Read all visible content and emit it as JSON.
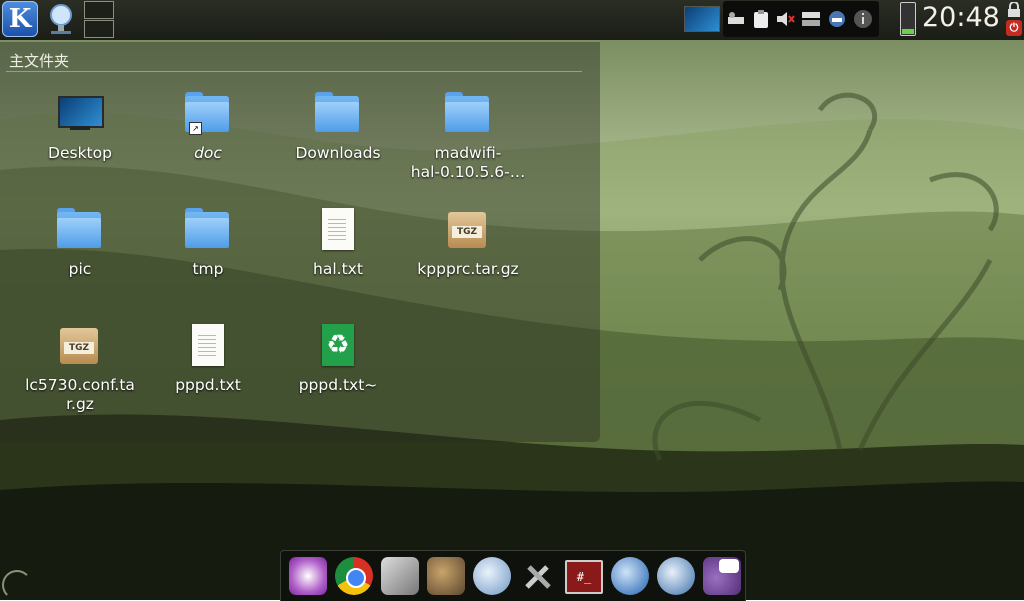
{
  "top_panel": {
    "kicker_letter": "K",
    "clock": "20:48",
    "battery_level": 0.15,
    "tray_icons": [
      "monitor-icon",
      "network-icon",
      "clipboard-icon",
      "volume-muted-icon",
      "display-icon",
      "device-notifier-icon",
      "info-icon"
    ],
    "power_glyph": "⏻"
  },
  "folder_view": {
    "title": "主文件夹",
    "items": [
      {
        "label": "Desktop",
        "icon": "desktop-icon"
      },
      {
        "label": "doc",
        "icon": "folder-link-icon"
      },
      {
        "label": "Downloads",
        "icon": "folder-icon"
      },
      {
        "label": "madwifi-\nhal-0.10.5.6-…",
        "icon": "folder-icon"
      },
      {
        "label": "pic",
        "icon": "folder-icon"
      },
      {
        "label": "tmp",
        "icon": "folder-icon"
      },
      {
        "label": "hal.txt",
        "icon": "text-file-icon"
      },
      {
        "label": "kppprc.tar.gz",
        "icon": "tgz-archive-icon"
      },
      {
        "label": "lc5730.conf.ta\nr.gz",
        "icon": "tgz-archive-icon"
      },
      {
        "label": "pppd.txt",
        "icon": "text-file-icon"
      },
      {
        "label": "pppd.txt~",
        "icon": "backup-file-icon"
      }
    ],
    "tgz_label": "TGZ",
    "link_badge": "↗",
    "recycle_glyph": "♻"
  },
  "dock": {
    "apps": [
      "kde-menu-icon",
      "chrome-icon",
      "video-editor-icon",
      "gimp-icon",
      "thunderbird-icon",
      "system-settings-icon",
      "terminal-icon",
      "network-globe-icon",
      "network-monitor-icon",
      "pidgin-icon"
    ],
    "terminal_glyph": "#_"
  }
}
